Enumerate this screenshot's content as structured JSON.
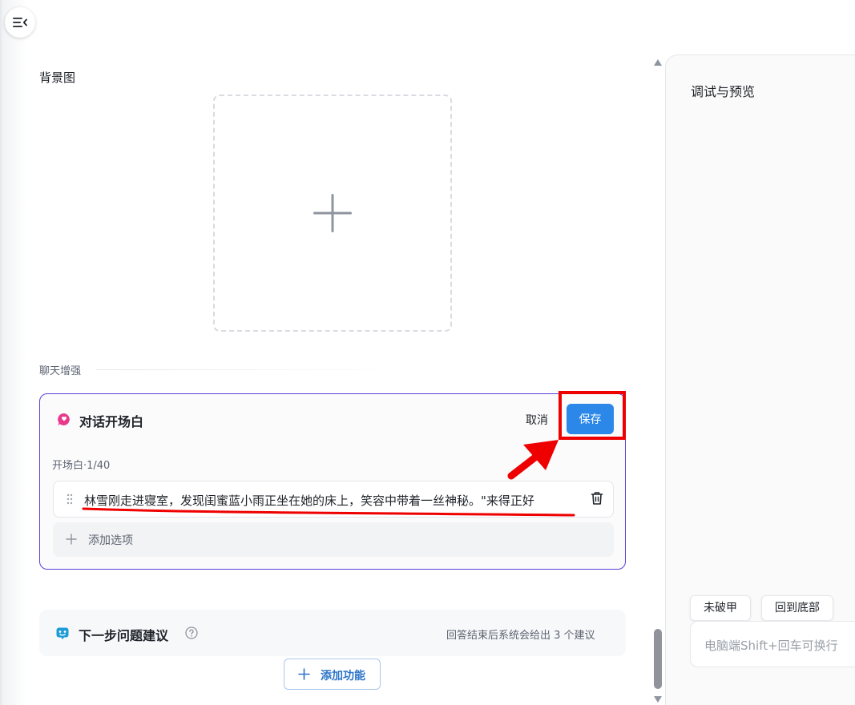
{
  "left": {
    "background_image_label": "背景图",
    "chat_enhance_label": "聊天增强",
    "opener": {
      "title": "对话开场白",
      "cancel_label": "取消",
      "save_label": "保存",
      "count": "开场白·1/40",
      "text": "林雪刚走进寝室，发现闺蜜蓝小雨正坐在她的床上，笑容中带着一丝神秘。\"来得正好",
      "add_option_label": "添加选项"
    },
    "next_suggestions": {
      "title": "下一步问题建议",
      "description": "回答结束后系统会给出 3 个建议"
    },
    "add_feature_label": "添加功能"
  },
  "right": {
    "title": "调试与预览",
    "chips": [
      "未破甲",
      "回到底部"
    ],
    "input_placeholder": "电脑端Shift+回车可换行"
  },
  "colors": {
    "accent": "#2b88e8",
    "card_border": "#5b3fd8",
    "annotation_red": "#ee0000"
  },
  "icons": {
    "menu": "menu-collapse-icon",
    "opener": "chat-bubble-icon",
    "next": "robot-face-icon",
    "help": "question-circle-icon",
    "delete": "trash-icon",
    "drag": "drag-handle-icon"
  }
}
